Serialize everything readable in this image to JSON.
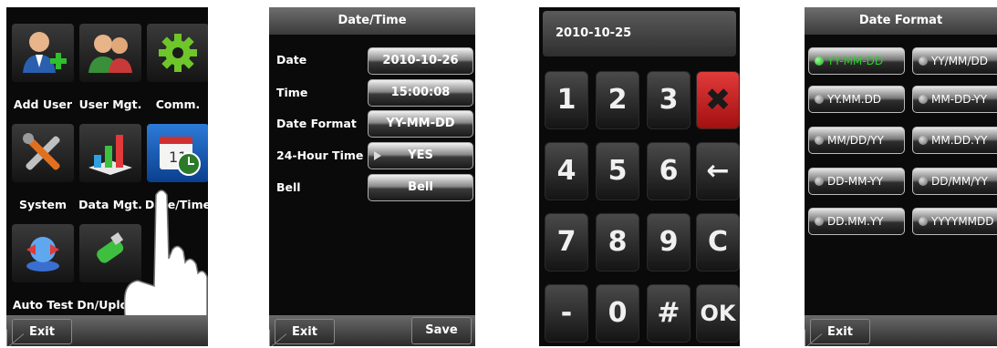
{
  "menu": {
    "tiles": [
      {
        "label": "Add User",
        "icon": "add-user-icon"
      },
      {
        "label": "User Mgt.",
        "icon": "user-management-icon"
      },
      {
        "label": "Comm.",
        "icon": "communication-gear-icon"
      },
      {
        "label": "System",
        "icon": "system-tools-icon"
      },
      {
        "label": "Data Mgt.",
        "icon": "data-management-chart-icon"
      },
      {
        "label": "Date/Time",
        "icon": "calendar-clock-icon"
      },
      {
        "label": "Auto Test",
        "icon": "auto-test-icon"
      },
      {
        "label": "Dn/Upload",
        "icon": "usb-drive-icon"
      }
    ],
    "exit_label": "Exit"
  },
  "datetime": {
    "title": "Date/Time",
    "rows": [
      {
        "label": "Date",
        "value": "2010-10-26"
      },
      {
        "label": "Time",
        "value": "15:00:08"
      },
      {
        "label": "Date Format",
        "value": "YY-MM-DD"
      },
      {
        "label": "24-Hour Time",
        "value": "YES"
      },
      {
        "label": "Bell",
        "value": "Bell"
      }
    ],
    "exit_label": "Exit",
    "save_label": "Save"
  },
  "keypad": {
    "display": "2010-10-25",
    "keys": [
      "1",
      "2",
      "3",
      "✖",
      "4",
      "5",
      "6",
      "←",
      "7",
      "8",
      "9",
      "C",
      "-",
      "0",
      "#",
      "OK"
    ]
  },
  "dateformat": {
    "title": "Date Format",
    "options": [
      "YY-MM-DD",
      "YY/MM/DD",
      "YY.MM.DD",
      "MM-DD-YY",
      "MM/DD/YY",
      "MM.DD.YY",
      "DD-MM-YY",
      "DD/MM/YY",
      "DD.MM.YY",
      "YYYYMMDD"
    ],
    "selected": "YY-MM-DD",
    "exit_label": "Exit"
  },
  "colors": {
    "selected_option": "#2bd12b",
    "delete_key": "#d42020",
    "date_time_tile": "#1a5fbf"
  }
}
